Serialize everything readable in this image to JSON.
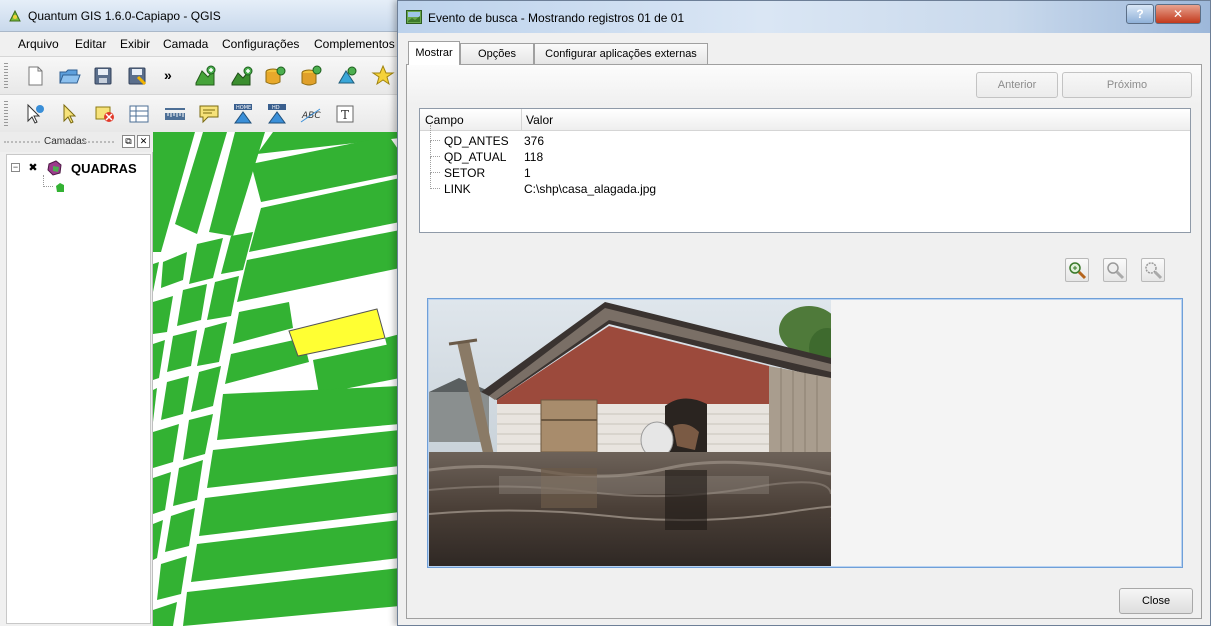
{
  "main_window": {
    "title": "Quantum GIS 1.6.0-Capiapo - QGIS",
    "menu": [
      "Arquivo",
      "Editar",
      "Exibir",
      "Camada",
      "Configurações",
      "Complementos"
    ],
    "overflow_glyph": "»",
    "layers_panel": {
      "title": "Camadas",
      "float_glyph": "⧉",
      "close_glyph": "✕",
      "expander_glyph": "−",
      "layer_check_glyph": "✖",
      "layer": {
        "name": "QUADRAS",
        "fill_color": "#33b233"
      }
    },
    "map": {
      "polygon_color": "#33b233",
      "selected_color": "#ffff33"
    }
  },
  "dialog": {
    "title": "Evento de busca - Mostrando registros 01 de 01",
    "help_glyph": "?",
    "close_glyph": "✕",
    "tabs": [
      "Mostrar",
      "Opções",
      "Configurar aplicações externas"
    ],
    "active_tab": 0,
    "buttons": {
      "previous": "Anterior",
      "next": "Próximo",
      "close": "Close"
    },
    "attributes": {
      "headers": {
        "field": "Campo",
        "value": "Valor"
      },
      "rows": [
        {
          "field": "QD_ANTES",
          "value": "376"
        },
        {
          "field": "QD_ATUAL",
          "value": "118"
        },
        {
          "field": "SETOR",
          "value": "1"
        },
        {
          "field": "LINK",
          "value": "C:\\shp\\casa_alagada.jpg"
        }
      ]
    },
    "zoom_tools": [
      "zoom-fit-icon",
      "zoom-in-icon",
      "zoom-out-icon"
    ]
  }
}
